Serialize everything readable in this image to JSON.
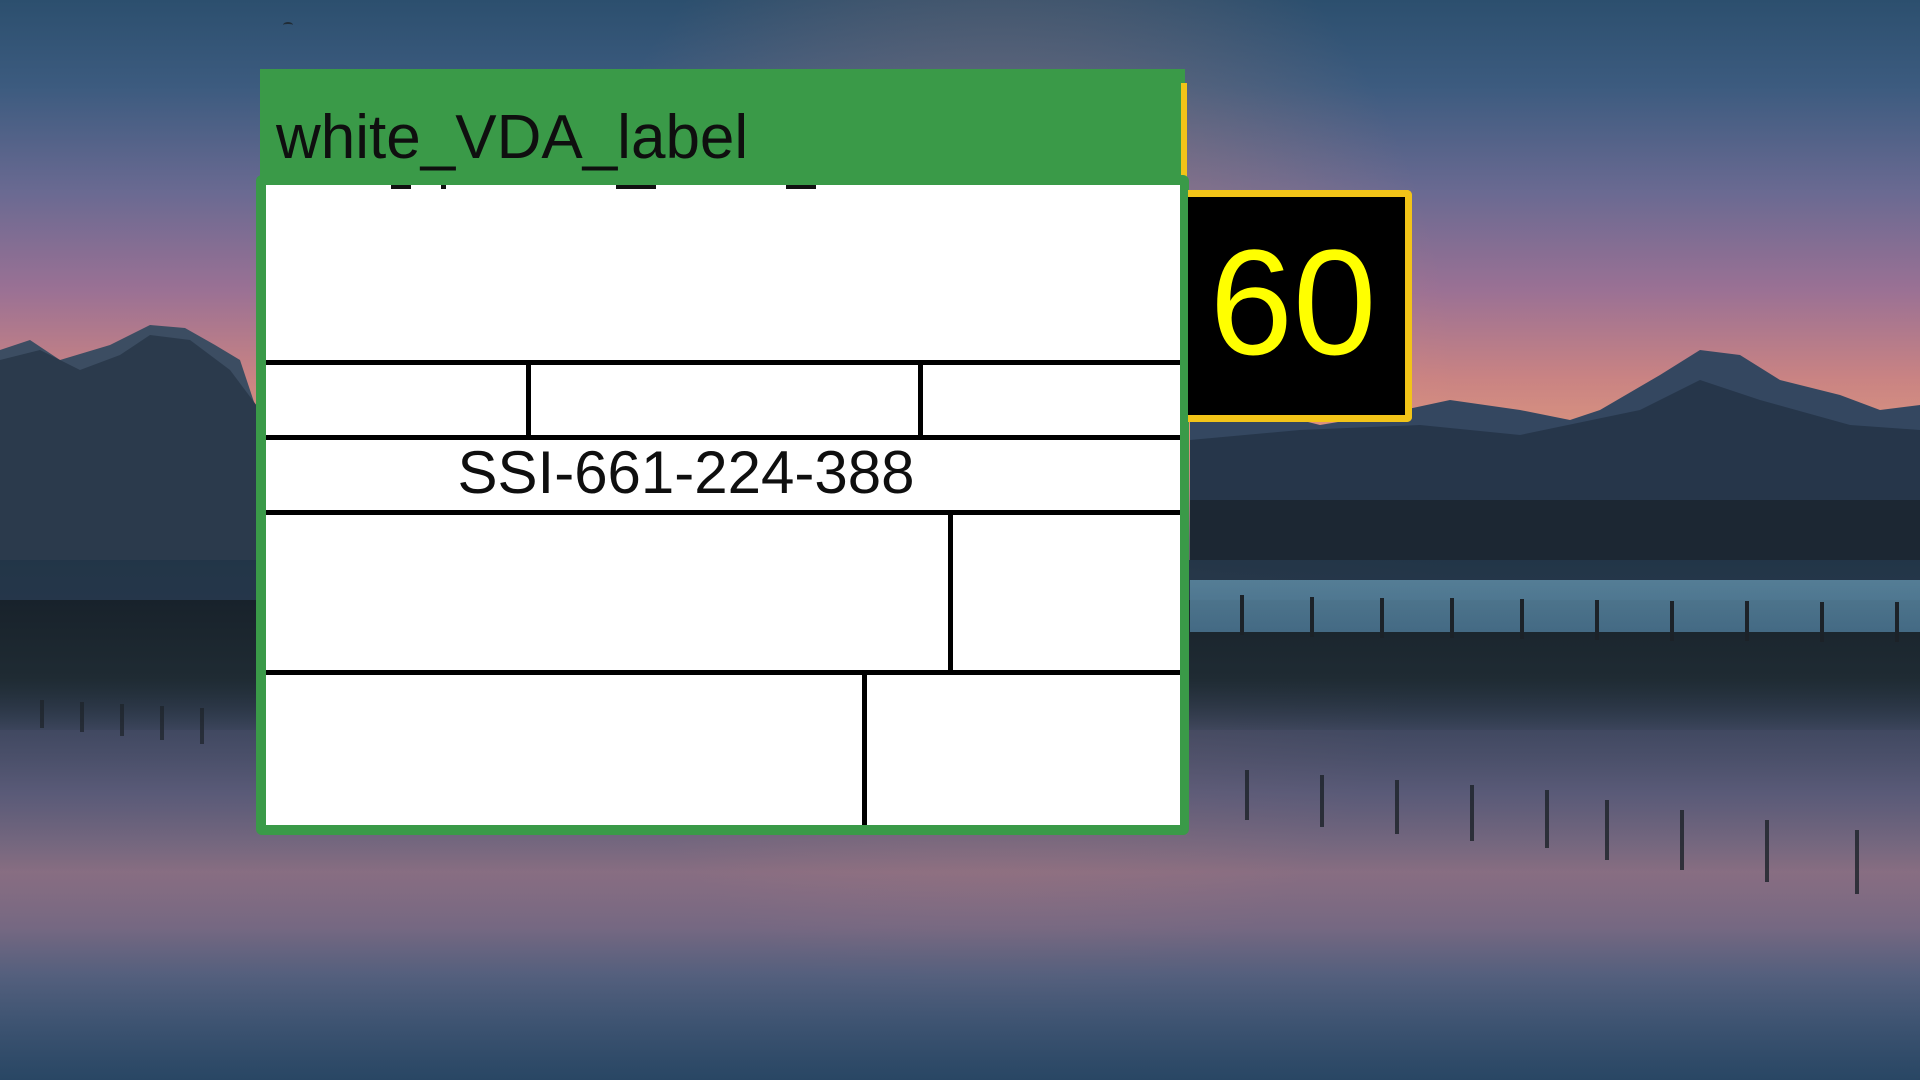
{
  "label_window": {
    "title": "white_VDA_label",
    "serial": "SSI-661-224-388"
  },
  "score_badge": {
    "value": "60"
  },
  "colors": {
    "window_frame": "#3a9a48",
    "badge_border": "#f2c418",
    "badge_text": "#ffff00",
    "badge_background": "#000000",
    "label_background": "#ffffff",
    "grid_lines": "#000000"
  }
}
